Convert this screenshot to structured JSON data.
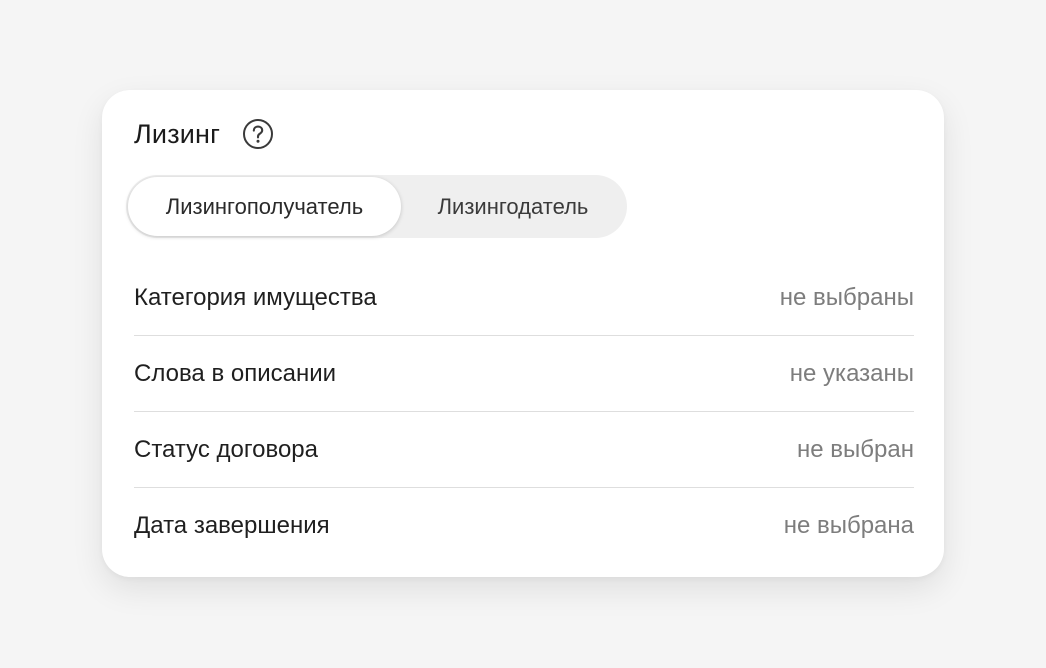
{
  "card": {
    "title": "Лизинг",
    "help_icon": "question-circle-icon"
  },
  "tabs": [
    {
      "label": "Лизингополучатель",
      "selected": true
    },
    {
      "label": "Лизингодатель",
      "selected": false
    }
  ],
  "rows": [
    {
      "label": "Категория имущества",
      "value": "не выбраны"
    },
    {
      "label": "Слова в описании",
      "value": "не указаны"
    },
    {
      "label": "Статус договора",
      "value": "не выбран"
    },
    {
      "label": "Дата завершения",
      "value": "не выбрана"
    }
  ],
  "colors": {
    "page_background": "#f5f5f5",
    "card_background": "#ffffff",
    "segment_track": "#efefef",
    "label_text": "#1f1f1f",
    "value_text": "#7d7d7d",
    "divider": "#dedede"
  }
}
